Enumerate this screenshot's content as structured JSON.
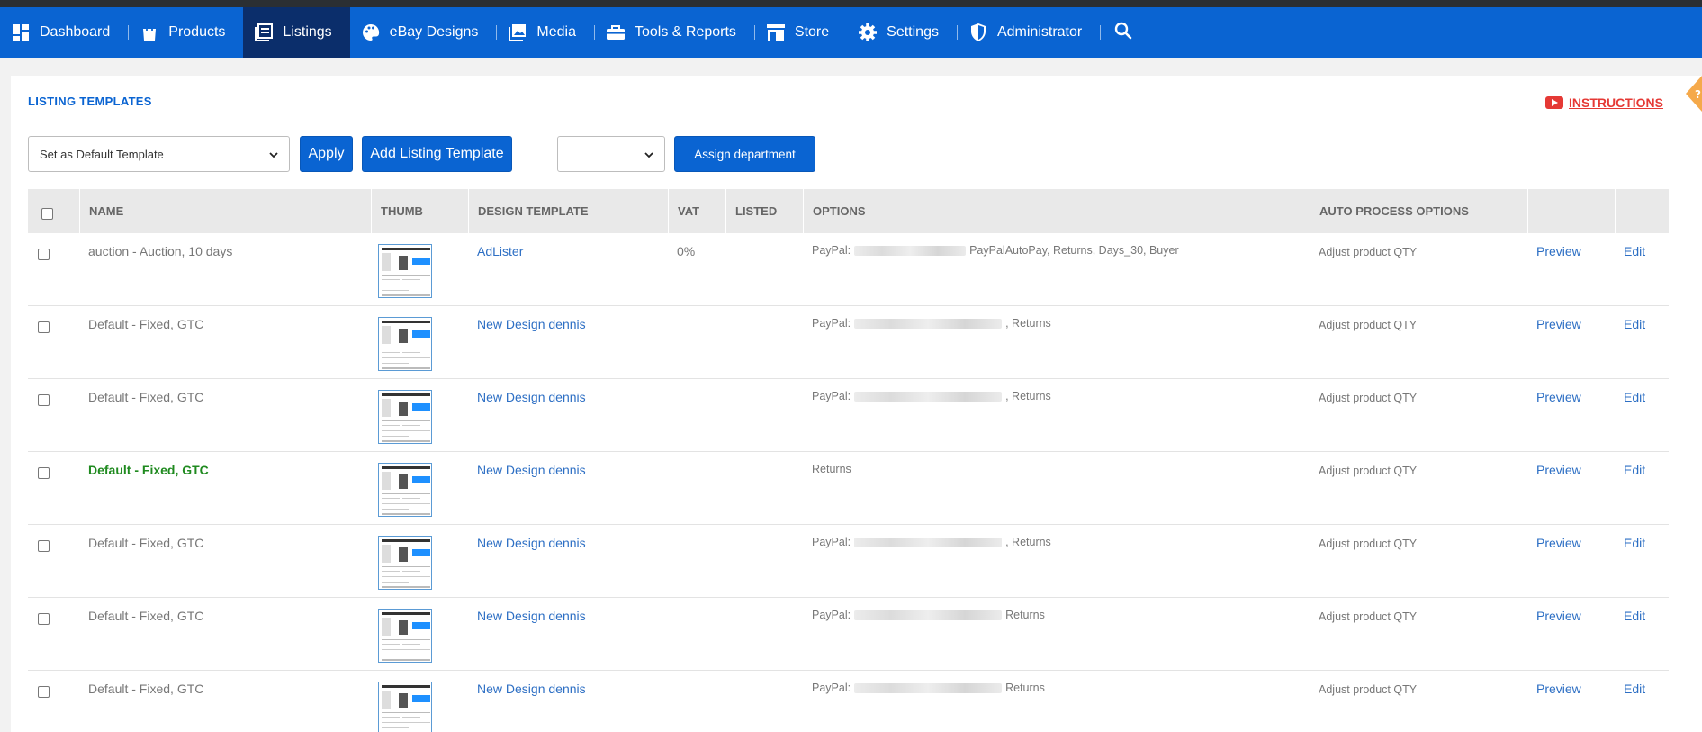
{
  "nav": {
    "items": [
      {
        "label": "Dashboard",
        "icon": "dashboard-icon"
      },
      {
        "label": "Products",
        "icon": "shopping-bag-icon"
      },
      {
        "label": "Listings",
        "icon": "listings-icon",
        "active": true
      },
      {
        "label": "eBay Designs",
        "icon": "palette-icon"
      },
      {
        "label": "Media",
        "icon": "image-icon"
      },
      {
        "label": "Tools & Reports",
        "icon": "toolbox-icon"
      },
      {
        "label": "Store",
        "icon": "store-icon"
      },
      {
        "label": "Settings",
        "icon": "gear-icon"
      },
      {
        "label": "Administrator",
        "icon": "shield-icon"
      }
    ],
    "search_icon": "search-icon"
  },
  "panel": {
    "title": "LISTING TEMPLATES",
    "instructions_label": "INSTRUCTIONS"
  },
  "toolbar": {
    "action_select_value": "Set as Default Template",
    "apply_label": "Apply",
    "add_label": "Add Listing Template",
    "department_select_value": "",
    "assign_label": "Assign department"
  },
  "table": {
    "headers": {
      "name": "NAME",
      "thumb": "THUMB",
      "design": "DESIGN TEMPLATE",
      "vat": "VAT",
      "listed": "LISTED",
      "options": "OPTIONS",
      "auto": "AUTO PROCESS OPTIONS"
    },
    "rows": [
      {
        "name": "auction - Auction, 10 days",
        "default": false,
        "design": "AdLister",
        "vat": "0%",
        "listed": "",
        "options_prefix": "PayPal:",
        "options_suffix": "PayPalAutoPay, Returns, Days_30, Buyer",
        "auto": "Adjust product QTY",
        "preview": "Preview",
        "edit": "Edit"
      },
      {
        "name": "Default - Fixed, GTC",
        "default": false,
        "design": "New Design dennis",
        "vat": "",
        "listed": "",
        "options_prefix": "PayPal:",
        "options_suffix": ", Returns",
        "auto": "Adjust product QTY",
        "preview": "Preview",
        "edit": "Edit"
      },
      {
        "name": "Default - Fixed, GTC",
        "default": false,
        "design": "New Design dennis",
        "vat": "",
        "listed": "",
        "options_prefix": "PayPal:",
        "options_suffix": ", Returns",
        "auto": "Adjust product QTY",
        "preview": "Preview",
        "edit": "Edit"
      },
      {
        "name": "Default - Fixed, GTC",
        "default": true,
        "design": "New Design dennis",
        "vat": "",
        "listed": "",
        "options_prefix": "",
        "options_suffix": "Returns",
        "auto": "Adjust product QTY",
        "preview": "Preview",
        "edit": "Edit"
      },
      {
        "name": "Default - Fixed, GTC",
        "default": false,
        "design": "New Design dennis",
        "vat": "",
        "listed": "",
        "options_prefix": "PayPal:",
        "options_suffix": ", Returns",
        "auto": "Adjust product QTY",
        "preview": "Preview",
        "edit": "Edit"
      },
      {
        "name": "Default - Fixed, GTC",
        "default": false,
        "design": "New Design dennis",
        "vat": "",
        "listed": "",
        "options_prefix": "PayPal:",
        "options_suffix": "Returns",
        "auto": "Adjust product QTY",
        "preview": "Preview",
        "edit": "Edit"
      },
      {
        "name": "Default - Fixed, GTC",
        "default": false,
        "design": "New Design dennis",
        "vat": "",
        "listed": "",
        "options_prefix": "PayPal:",
        "options_suffix": "Returns",
        "auto": "Adjust product QTY",
        "preview": "Preview",
        "edit": "Edit"
      }
    ]
  },
  "colors": {
    "nav_bg": "#0a64d2",
    "nav_active_bg": "#0b2e6b",
    "link": "#2d6fc4",
    "default_name": "#1f8a1f",
    "instructions": "#e53935"
  }
}
